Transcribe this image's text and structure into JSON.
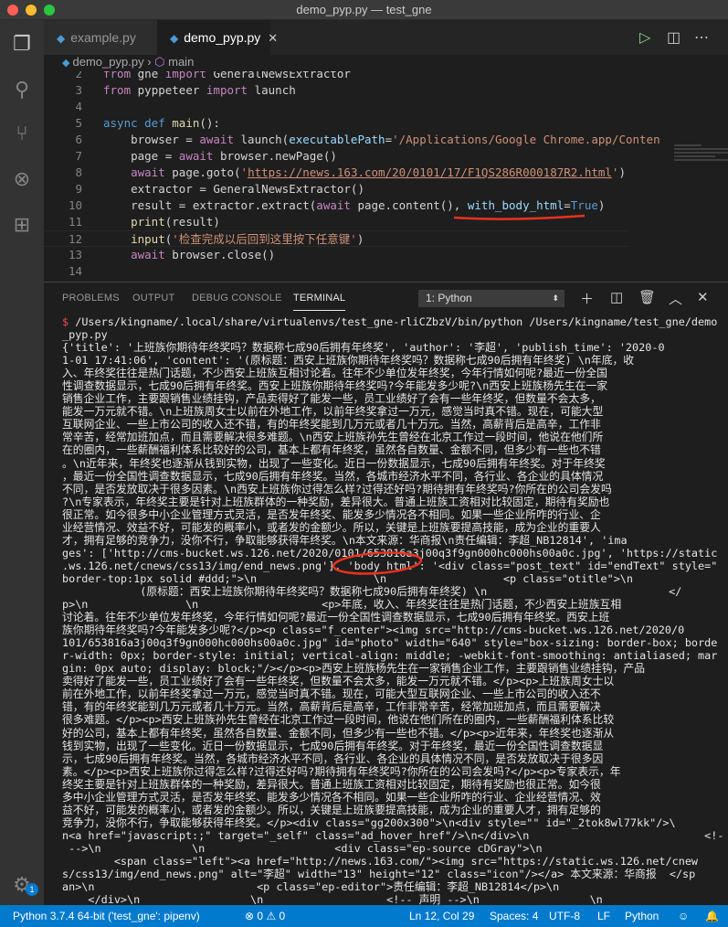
{
  "window": {
    "title": "demo_pyp.py — test_gne"
  },
  "activity_bar": {
    "items": [
      "explorer-icon",
      "search-icon",
      "source-control-icon",
      "debug-icon",
      "extensions-icon"
    ],
    "settings_badge": "1"
  },
  "tabs": [
    {
      "label": "example.py",
      "active": false
    },
    {
      "label": "demo_pyp.py",
      "active": true
    }
  ],
  "breadcrumb": {
    "file": "demo_pyp.py",
    "symbol": "main"
  },
  "editor": {
    "lines": [
      {
        "n": "2",
        "tokens": [
          [
            "from ",
            "kw2"
          ],
          [
            "gne ",
            "pl"
          ],
          [
            "import ",
            "kw2"
          ],
          [
            "GeneralNewsExtractor",
            "pl"
          ]
        ]
      },
      {
        "n": "3",
        "tokens": [
          [
            "from ",
            "kw2"
          ],
          [
            "pyppeteer ",
            "pl"
          ],
          [
            "import ",
            "kw2"
          ],
          [
            "launch",
            "pl"
          ]
        ]
      },
      {
        "n": "4",
        "tokens": []
      },
      {
        "n": "5",
        "tokens": [
          [
            "async ",
            "kw"
          ],
          [
            "def ",
            "kw"
          ],
          [
            "main",
            "fn"
          ],
          [
            "():",
            "pl"
          ]
        ]
      },
      {
        "n": "6",
        "tokens": [
          [
            "    browser = ",
            "pl"
          ],
          [
            "await ",
            "kw2"
          ],
          [
            "launch(",
            "pl"
          ],
          [
            "executablePath",
            "var"
          ],
          [
            "=",
            "pl"
          ],
          [
            "'/Applications/Google Chrome.app/Conten",
            "str"
          ]
        ]
      },
      {
        "n": "7",
        "tokens": [
          [
            "    page = ",
            "pl"
          ],
          [
            "await ",
            "kw2"
          ],
          [
            "browser.newPage()",
            "pl"
          ]
        ]
      },
      {
        "n": "8",
        "tokens": [
          [
            "    ",
            "pl"
          ],
          [
            "await ",
            "kw2"
          ],
          [
            "page.goto(",
            "pl"
          ],
          [
            "'",
            "str"
          ],
          [
            "https://news.163.com/20/0101/17/F1QS286R000187R2.html",
            "url"
          ],
          [
            "'",
            "str"
          ],
          [
            ")",
            "pl"
          ]
        ]
      },
      {
        "n": "9",
        "tokens": [
          [
            "    extractor = GeneralNewsExtractor()",
            "pl"
          ]
        ]
      },
      {
        "n": "10",
        "tokens": [
          [
            "    result = extractor.extract(",
            "pl"
          ],
          [
            "await ",
            "kw2"
          ],
          [
            "page.content(), ",
            "pl"
          ],
          [
            "with_body_html",
            "var"
          ],
          [
            "=",
            "pl"
          ],
          [
            "True",
            "kw"
          ],
          [
            ")",
            "pl"
          ]
        ]
      },
      {
        "n": "11",
        "tokens": [
          [
            "    ",
            "pl"
          ],
          [
            "print",
            "fn"
          ],
          [
            "(result)",
            "pl"
          ]
        ]
      },
      {
        "n": "12",
        "tokens": [
          [
            "    ",
            "pl"
          ],
          [
            "input",
            "fn"
          ],
          [
            "(",
            "pl"
          ],
          [
            "'检查完成以后回到这里按下任意键'",
            "str"
          ],
          [
            ")",
            "pl"
          ]
        ]
      },
      {
        "n": "13",
        "tokens": [
          [
            "    ",
            "pl"
          ],
          [
            "await ",
            "kw2"
          ],
          [
            "browser.close()",
            "pl"
          ]
        ]
      },
      {
        "n": "14",
        "tokens": []
      }
    ]
  },
  "panel": {
    "tabs": [
      "PROBLEMS",
      "OUTPUT",
      "DEBUG CONSOLE",
      "TERMINAL"
    ],
    "active_tab": "TERMINAL",
    "terminal_select": "1: Python"
  },
  "terminal": {
    "prompt": "$",
    "lines": [
      " /Users/kingname/.local/share/virtualenvs/test_gne-rliCZbzV/bin/python /Users/kingname/test_gne/demo",
      "_pyp.py",
      "{'title': '上班族你期待年终奖吗？数据称七成90后拥有年终奖', 'author': '李超', 'publish_time': '2020-0",
      "1-01 17:41:06', 'content': '(原标题：西安上班族你期待年终奖吗？数据称七成90后拥有年终奖) \\n年底，收",
      "入、年终奖往往是热门话题，不少西安上班族互相讨论着。往年不少单位发年终奖，今年行情如何呢?最近一份全国",
      "性调查数据显示，七成90后拥有年终奖。西安上班族你期待年终奖吗?今年能发多少呢?\\n西安上班族杨先生在一家",
      "销售企业工作，主要跟销售业绩挂钩，产品卖得好了能发一些，员工业绩好了会有一些年终奖，但数量不会太多，",
      "能发一万元就不错。\\n上班族周女士以前在外地工作，以前年终奖拿过一万元，感觉当时真不错。现在，可能大型",
      "互联网企业、一些上市公司的收入还不错，有的年终奖能到几万元或者几十万元。当然，高薪背后是高辛，工作非",
      "常辛苦，经常加班加点，而且需要解决很多难题。\\n西安上班族孙先生曾经在北京工作过一段时间，他说在他们所",
      "在的圈内，一些薪酬福利体系比较好的公司，基本上都有年终奖，虽然各自数量、金额不同，但多少有一些也不错",
      "。\\n近年来，年终奖也逐渐从钱到实物，出现了一些变化。近日一份数据显示，七成90后拥有年终奖。对于年终奖",
      "，最近一份全国性调查数据显示，七成90后拥有年终奖。当然，各城市经济水平不同，各行业、各企业的具体情况",
      "不同，是否发放取决于很多因素。\\n西安上班族你过得怎么样?过得还好吗?期待拥有年终奖吗?你所在的公司会发吗",
      "?\\n专家表示，年终奖主要是针对上班族群体的一种奖励，差异很大。普通上班族工资相对比较固定，期待有奖励也",
      "很正常。如今很多中小企业管理方式灵活，是否发年终奖、能发多少情况各不相同。如果一些企业所咋的行业、企",
      "业经营情况、效益不好，可能发的概率小，或者发的金额少。所以，关键是上班族要提高技能，成为企业的重要人",
      "才，拥有足够的竞争力，没你不行，争取能够获得年终奖。\\n本文来源：华商报\\n责任编辑：李超_NB12814', 'ima",
      "ges': ['http://cms-bucket.ws.126.net/2020/0101/653816a3j00q3f9gn000hc000hs00a0c.jpg', 'https://static",
      ".ws.126.net/cnews/css13/img/end_news.png'], 'body_html': '<div class=\"post_text\" id=\"endText\" style=\"",
      "border-top:1px solid #ddd;\">\\n                  \\n                  <p class=\"otitle\">\\n",
      "            (原标题：西安上班族你期待年终奖吗？数据称七成90后拥有年终奖) \\n                            </",
      "p>\\n               \\n                   <p>年底，收入、年终奖往往是热门话题，不少西安上班族互相",
      "讨论着。往年不少单位发年终奖，今年行情如何呢?最近一份全国性调查数据显示，七成90后拥有年终奖。西安上班",
      "族你期待年终奖吗?今年能发多少呢?</p><p class=\"f_center\"><img src=\"http://cms-bucket.ws.126.net/2020/0",
      "101/653816a3j00q3f9gn000hc000hs00a0c.jpg\" id=\"photo\" width=\"640\" style=\"box-sizing: border-box; borde",
      "r-width: 0px; border-style: initial; vertical-align: middle; -webkit-font-smoothing: antialiased; mar",
      "gin: 0px auto; display: block;\"/></p><p>西安上班族杨先生在一家销售企业工作，主要跟销售业绩挂钩，产品",
      "卖得好了能发一些，员工业绩好了会有一些年终奖，但数量不会太多，能发一万元就不错。</p><p>上班族周女士以",
      "前在外地工作，以前年终奖拿过一万元，感觉当时真不错。现在，可能大型互联网企业、一些上市公司的收入还不",
      "错，有的年终奖能到几万元或者几十万元。当然，高薪背后是高辛，工作非常辛苦，经常加班加点，而且需要解决",
      "很多难题。</p><p>西安上班族孙先生曾经在北京工作过一段时间，他说在他们所在的圈内，一些薪酬福利体系比较",
      "好的公司，基本上都有年终奖，虽然各自数量、金额不同，但多少有一些也不错。</p><p>近年来，年终奖也逐渐从",
      "钱到实物，出现了一些变化。近日一份数据显示，七成90后拥有年终奖。对于年终奖，最近一份全国性调查数据显",
      "示，七成90后拥有年终奖。当然，各城市经济水平不同，各行业、各企业的具体情况不同，是否发放取决于很多因",
      "素。</p><p>西安上班族你过得怎么样?过得还好吗?期待拥有年终奖吗?你所在的公司会发吗?</p><p>专家表示，年",
      "终奖主要是针对上班族群体的一种奖励，差异很大。普通上班族工资相对比较固定，期待有奖励也很正常。如今很",
      "多中小企业管理方式灵活，是否发年终奖、能发多少情况各不相同。如果一些企业所咋的行业、企业经营情况、效",
      "益不好，可能发的概率小，或者发的金额少。所以，关键是上班族要提高技能，成为企业的重要人才，拥有足够的",
      "竞争力，没你不行，争取能够获得年终奖。</p><div class=\"gg200x300\">\\n<div style=\"\" id=\"_2tok8wl77kk\"/>\\",
      "n<a href=\"javascript:;\" target=\"_self\" class=\"ad_hover_href\"/>\\n</div>\\n                           <!-- 作者",
      " -->\\n              \\n                    <div class=\"ep-source cDGray\">\\n",
      "        <span class=\"left\"><a href=\"http://news.163.com/\"><img src=\"https://static.ws.126.net/cnew",
      "s/css13/img/end_news.png\" alt=\"李超\" width=\"13\" height=\"12\" class=\"icon\"/></a> 本文来源：华商报  </sp",
      "an>\\n                         <p class=\"ep-editor\">责任编辑：李超_NB12814</p>\\n",
      "    </div>\\n                 \\n                   <!-- 声明 -->\\n                 \\n"
    ]
  },
  "status_bar": {
    "interpreter": "Python 3.7.4 64-bit ('test_gne': pipenv)",
    "errors": "0",
    "warnings": "0",
    "position": "Ln 12, Col 29",
    "spaces": "Spaces: 4",
    "encoding": "UTF-8",
    "eol": "LF",
    "language": "Python"
  },
  "colors": {
    "status_bar": "#007acc",
    "annotation": "#e8321e"
  }
}
